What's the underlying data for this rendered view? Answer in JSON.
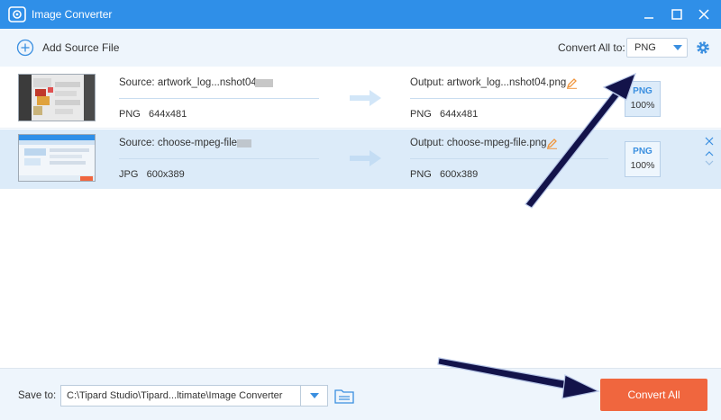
{
  "window": {
    "title": "Image Converter"
  },
  "toolbar": {
    "add_source_label": "Add Source File",
    "convert_all_to_label": "Convert All to:",
    "format_value": "PNG"
  },
  "files": [
    {
      "source_name": "Source: artwork_log...nshot04.",
      "source_format": "PNG",
      "source_size": "644x481",
      "output_name": "Output: artwork_log...nshot04.png",
      "output_format": "PNG",
      "output_size": "644x481",
      "badge_format": "PNG",
      "badge_quality": "100%"
    },
    {
      "source_name": "Source: choose-mpeg-file.",
      "source_format": "JPG",
      "source_size": "600x389",
      "output_name": "Output: choose-mpeg-file.png",
      "output_format": "PNG",
      "output_size": "600x389",
      "badge_format": "PNG",
      "badge_quality": "100%"
    }
  ],
  "footer": {
    "save_to_label": "Save to:",
    "save_path": "C:\\Tipard Studio\\Tipard...ltimate\\Image Converter",
    "convert_all_button": "Convert All"
  },
  "colors": {
    "title_bar": "#2f8fe8",
    "accent": "#3a8fe0",
    "convert_button": "#f0663e",
    "selected_row": "#dcebf9",
    "annotation_arrow": "#13134a"
  },
  "icons": [
    "app-logo-icon",
    "minimize-icon",
    "maximize-icon",
    "close-icon",
    "add-circle-icon",
    "chevron-down-icon",
    "gear-icon",
    "right-arrow-icon",
    "edit-pencil-icon",
    "remove-icon",
    "move-up-icon",
    "move-down-icon",
    "folder-icon"
  ]
}
